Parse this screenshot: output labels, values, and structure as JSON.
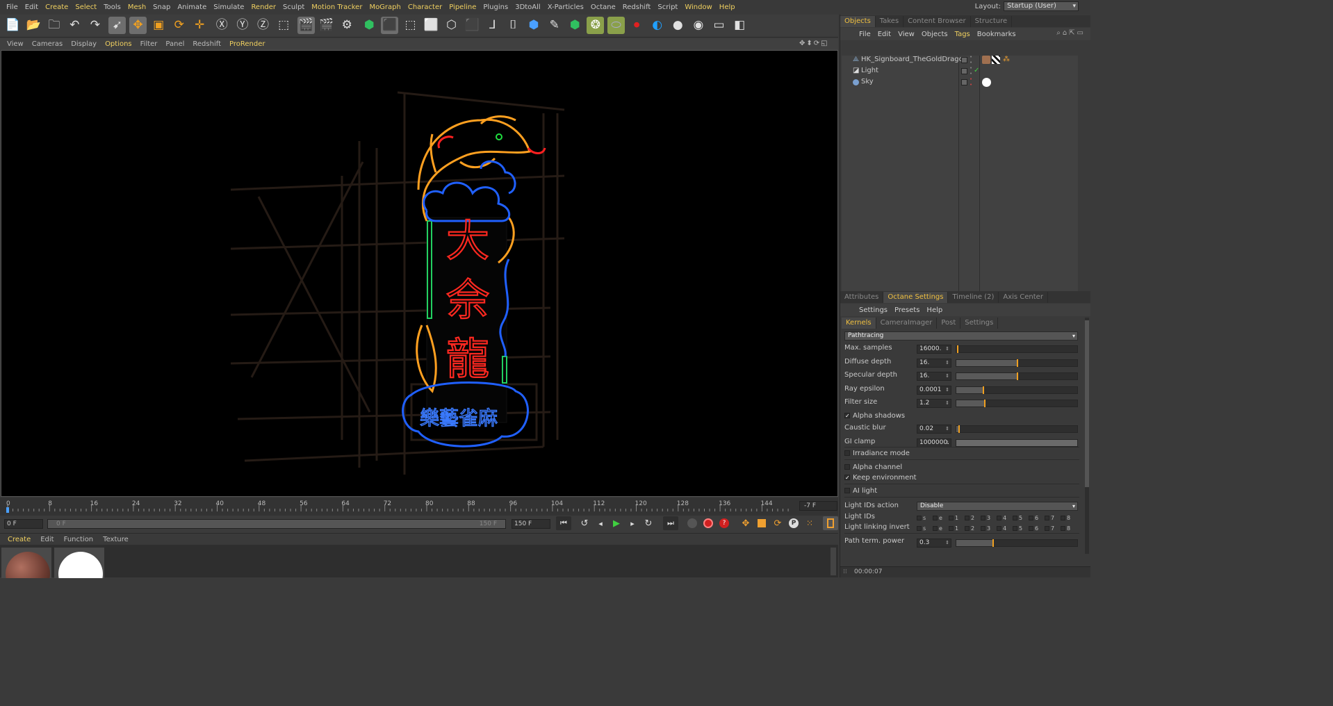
{
  "menubar": {
    "items": [
      "File",
      "Edit",
      "Create",
      "Select",
      "Tools",
      "Mesh",
      "Snap",
      "Animate",
      "Simulate",
      "Render",
      "Sculpt",
      "Motion Tracker",
      "MoGraph",
      "Character",
      "Pipeline",
      "Plugins",
      "3DtoAll",
      "X-Particles",
      "Octane",
      "Redshift",
      "Script",
      "Window",
      "Help"
    ],
    "layout_label": "Layout:",
    "layout_value": "Startup (User)"
  },
  "viewport_menu": {
    "items": [
      "View",
      "Cameras",
      "Display",
      "Options",
      "Filter",
      "Panel",
      "Redshift",
      "ProRender"
    ]
  },
  "sign": {
    "characters": [
      "大",
      "佘",
      "龍"
    ],
    "footer_text": "樂藝雀麻"
  },
  "timeline": {
    "ticks": [
      "0",
      "8",
      "16",
      "24",
      "32",
      "40",
      "48",
      "56",
      "64",
      "72",
      "80",
      "88",
      "96",
      "104",
      "112",
      "120",
      "128",
      "136",
      "144"
    ],
    "current_frame_right": "-7 F",
    "start_field": "0 F",
    "range_start": "0 F",
    "range_end": "150 F",
    "end_field": "150 F"
  },
  "material_manager": {
    "menu": [
      "Create",
      "Edit",
      "Function",
      "Texture"
    ]
  },
  "objects_panel": {
    "tabs": [
      "Objects",
      "Takes",
      "Content Browser",
      "Structure"
    ],
    "menu": [
      "File",
      "Edit",
      "View",
      "Objects",
      "Tags",
      "Bookmarks"
    ],
    "rows": [
      {
        "name": "HK_Signboard_TheGoldDragon"
      },
      {
        "name": "Light"
      },
      {
        "name": "Sky"
      }
    ]
  },
  "attributes_panel": {
    "tabs": [
      "Attributes",
      "Octane Settings",
      "Timeline (2)",
      "Axis Center"
    ],
    "menu": [
      "Settings",
      "Presets",
      "Help"
    ],
    "subtabs": [
      "Kernels",
      "CameraImager",
      "Post",
      "Settings"
    ],
    "kernel": "Pathtracing",
    "params": [
      {
        "label": "Max. samples",
        "value": "16000.",
        "fill": 0.0
      },
      {
        "label": "Diffuse depth",
        "value": "16.",
        "fill": 0.5
      },
      {
        "label": "Specular depth",
        "value": "16.",
        "fill": 0.5
      },
      {
        "label": "Ray epsilon",
        "value": "0.0001",
        "fill": 0.22
      },
      {
        "label": "Filter size",
        "value": "1.2",
        "fill": 0.23
      }
    ],
    "alpha_shadows": "Alpha shadows",
    "params2": [
      {
        "label": "Caustic blur",
        "value": "0.02",
        "fill": 0.02
      },
      {
        "label": "GI clamp",
        "value": "1000000.",
        "fill": 1.0
      }
    ],
    "irradiance_mode": "Irradiance mode",
    "alpha_channel": "Alpha channel",
    "keep_environment": "Keep environment",
    "ai_light": "AI light",
    "light_ids_action_label": "Light IDs action",
    "light_ids_action_value": "Disable",
    "light_ids_label": "Light IDs",
    "light_linking_label": "Light linking invert",
    "id_labels": [
      "s",
      "e",
      "1",
      "2",
      "3",
      "4",
      "5",
      "6",
      "7",
      "8"
    ],
    "path_term_label": "Path term. power",
    "path_term_value": "0.3",
    "path_term_fill": 0.3,
    "status": "00:00:07"
  }
}
